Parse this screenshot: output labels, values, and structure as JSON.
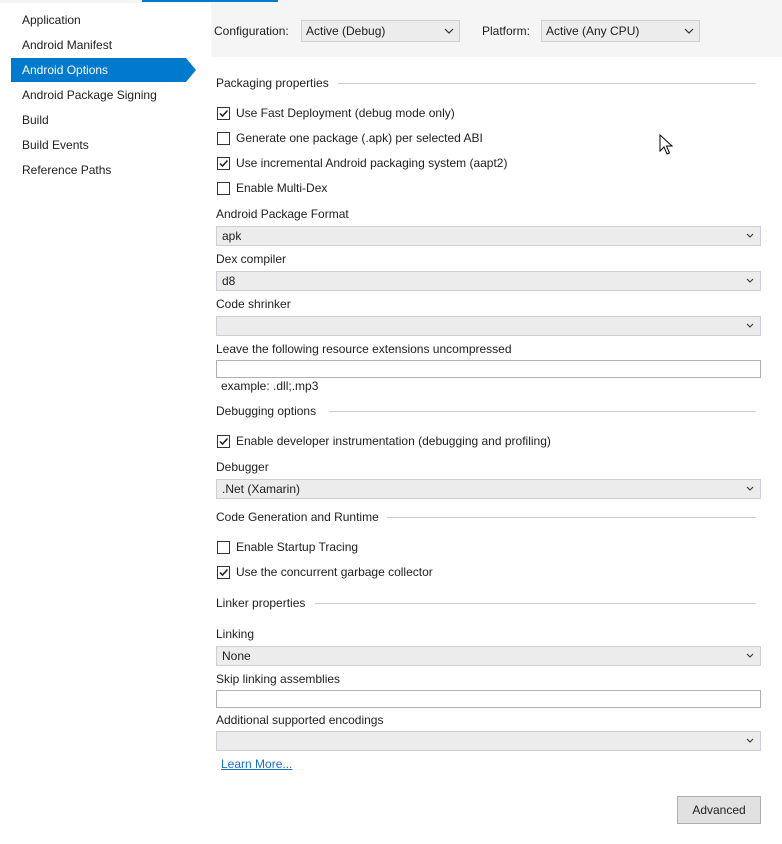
{
  "sidebar": {
    "items": [
      {
        "label": "Application",
        "selected": false
      },
      {
        "label": "Android Manifest",
        "selected": false
      },
      {
        "label": "Android Options",
        "selected": true
      },
      {
        "label": "Android Package Signing",
        "selected": false
      },
      {
        "label": "Build",
        "selected": false
      },
      {
        "label": "Build Events",
        "selected": false
      },
      {
        "label": "Reference Paths",
        "selected": false
      }
    ]
  },
  "header": {
    "configuration_label": "Configuration:",
    "configuration_value": "Active (Debug)",
    "platform_label": "Platform:",
    "platform_value": "Active (Any CPU)"
  },
  "packaging": {
    "title": "Packaging properties",
    "fast_deployment": {
      "label": "Use Fast Deployment (debug mode only)",
      "checked": true
    },
    "per_abi": {
      "label": "Generate one package (.apk) per selected ABI",
      "checked": false
    },
    "aapt2": {
      "label": "Use incremental Android packaging system (aapt2)",
      "checked": true
    },
    "multidex": {
      "label": "Enable Multi-Dex",
      "checked": false
    },
    "package_format": {
      "label": "Android Package Format",
      "value": "apk"
    },
    "dex_compiler": {
      "label": "Dex compiler",
      "value": "d8"
    },
    "code_shrinker": {
      "label": "Code shrinker",
      "value": ""
    },
    "uncompressed": {
      "label": "Leave the following resource extensions uncompressed",
      "value": "",
      "hint": "example: .dll;.mp3"
    }
  },
  "debugging": {
    "title": "Debugging options",
    "instrumentation": {
      "label": "Enable developer instrumentation (debugging and profiling)",
      "checked": true
    },
    "debugger": {
      "label": "Debugger",
      "value": ".Net (Xamarin)"
    }
  },
  "codegen": {
    "title": "Code Generation and Runtime",
    "startup_tracing": {
      "label": "Enable Startup Tracing",
      "checked": false
    },
    "concurrent_gc": {
      "label": "Use the concurrent garbage collector",
      "checked": true
    }
  },
  "linker": {
    "title": "Linker properties",
    "linking": {
      "label": "Linking",
      "value": "None"
    },
    "skip_assemblies": {
      "label": "Skip linking assemblies",
      "value": ""
    },
    "encodings": {
      "label": "Additional supported encodings",
      "value": ""
    },
    "learn_more": "Learn More..."
  },
  "advanced_label": "Advanced",
  "icons": {
    "chevron": "chevron-down-icon",
    "check": "checkmark-icon",
    "cursor": "mouse-pointer-icon"
  }
}
